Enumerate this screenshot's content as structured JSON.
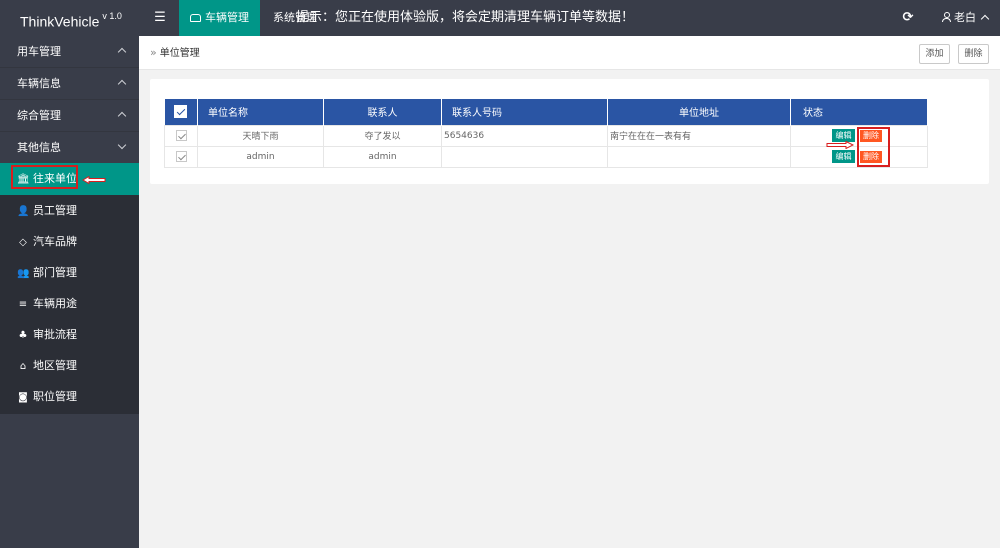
{
  "app": {
    "name": "ThinkVehicle",
    "version": "v 1.0"
  },
  "topbar": {
    "menu_icon": "menu-icon",
    "active_nav": "车辆管理",
    "second_nav": "系统管理",
    "notice": "提示：您正在使用体验版，将会定期清理车辆订单等数据！",
    "user_name": "老白",
    "refresh_icon": "refresh-icon"
  },
  "sidebar": {
    "groups": [
      {
        "label": "用车管理",
        "chevron": "up"
      },
      {
        "label": "车辆信息",
        "chevron": "up"
      },
      {
        "label": "综合管理",
        "chevron": "up"
      },
      {
        "label": "其他信息",
        "chevron": "down"
      }
    ],
    "items": [
      {
        "label": "往来单位",
        "icon": "bank-icon",
        "active": true
      },
      {
        "label": "员工管理",
        "icon": "user-icon"
      },
      {
        "label": "汽车品牌",
        "icon": "diamond-icon"
      },
      {
        "label": "部门管理",
        "icon": "users-icon"
      },
      {
        "label": "车辆用途",
        "icon": "list-icon"
      },
      {
        "label": "审批流程",
        "icon": "flow-icon"
      },
      {
        "label": "地区管理",
        "icon": "home-icon"
      },
      {
        "label": "职位管理",
        "icon": "camera-icon"
      }
    ]
  },
  "breadcrumb": {
    "current": "单位管理"
  },
  "actions": {
    "add": "添加",
    "delete": "删除"
  },
  "table": {
    "headers": [
      "单位名称",
      "联系人",
      "联系人号码",
      "单位地址",
      "状态"
    ],
    "rows": [
      {
        "name": "天晴下雨",
        "contact": "夺了发以",
        "phone": "5654636",
        "address": "南宁在在在一表有有",
        "edit": "编辑",
        "remove": "删除"
      },
      {
        "name": "admin",
        "contact": "admin",
        "phone": "",
        "address": "",
        "edit": "编辑",
        "remove": "删除"
      }
    ]
  },
  "colors": {
    "header_bg": "#393d49",
    "accent": "#009688",
    "table_head": "#2a55a4",
    "danger": "#ff5722",
    "highlight": "#d81e1e"
  }
}
